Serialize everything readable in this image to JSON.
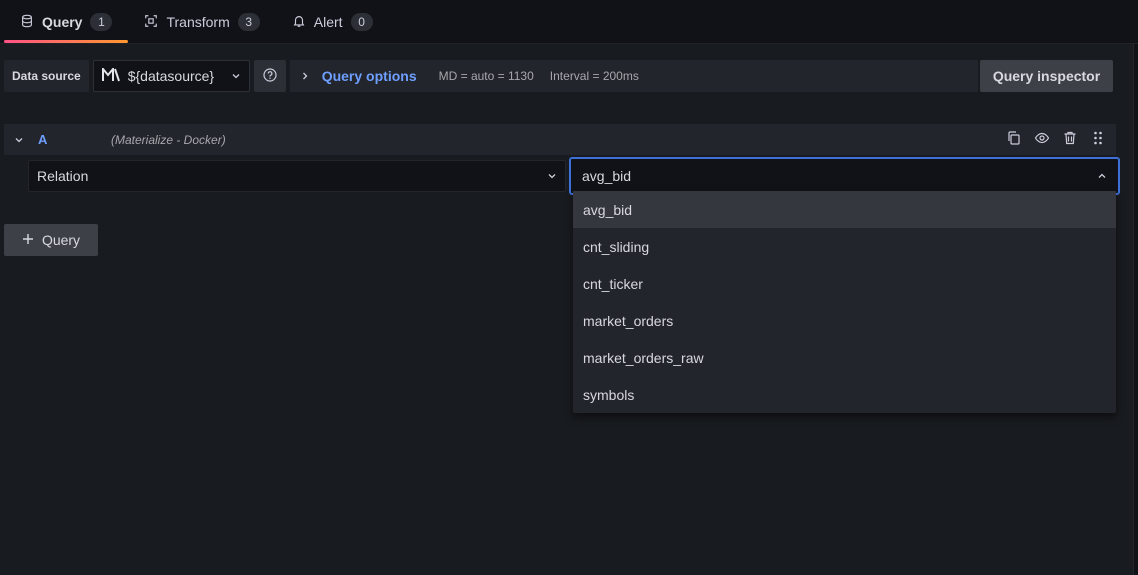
{
  "tabs": [
    {
      "label": "Query",
      "count": "1",
      "icon": "database-icon",
      "active": true
    },
    {
      "label": "Transform",
      "count": "3",
      "icon": "transform-icon",
      "active": false
    },
    {
      "label": "Alert",
      "count": "0",
      "icon": "bell-icon",
      "active": false
    }
  ],
  "toolbar": {
    "datasource_label": "Data source",
    "datasource_value": "${datasource}",
    "query_options_label": "Query options",
    "md_text": "MD = auto = 1130",
    "interval_text": "Interval = 200ms",
    "inspector_label": "Query inspector"
  },
  "query": {
    "ref_id": "A",
    "datasource_note": "(Materialize - Docker)",
    "relation_label": "Relation",
    "relation_value": "avg_bid",
    "options": [
      "avg_bid",
      "cnt_sliding",
      "cnt_ticker",
      "market_orders",
      "market_orders_raw",
      "symbols"
    ],
    "highlighted": "avg_bid"
  },
  "add_query_label": "Query",
  "colors": {
    "accent": "#6e9fff",
    "focus_border": "#3d71d9",
    "tab_underline_start": "#ff5286",
    "tab_underline_end": "#ff9830"
  }
}
